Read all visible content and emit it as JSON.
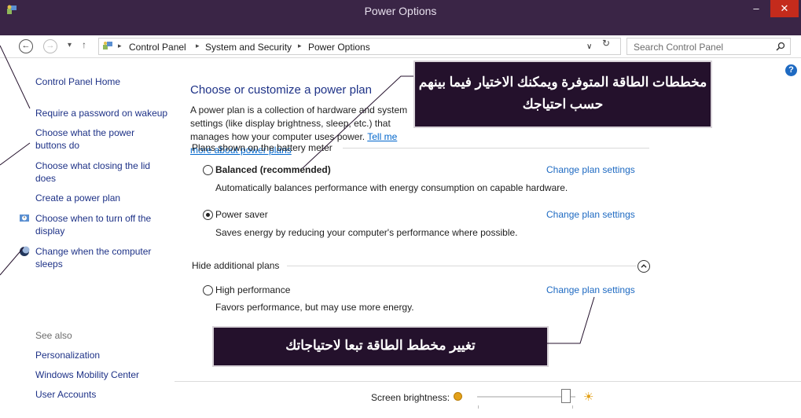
{
  "window": {
    "title": "Power Options",
    "minimize": "–",
    "maximize": "□",
    "close": "✕"
  },
  "address": {
    "back": "←",
    "forward": "→",
    "dropdown": "▾",
    "up": "↑",
    "breadcrumbs": [
      "Control Panel",
      "System and Security",
      "Power Options"
    ],
    "sep": "▸",
    "history": "∨",
    "refresh": "↻",
    "search_placeholder": "Search Control Panel"
  },
  "sidebar": {
    "home": "Control Panel Home",
    "items": [
      "Require a password on wakeup",
      "Choose what the power buttons do",
      "Choose what closing the lid does",
      "Create a power plan",
      "Choose when to turn off the display",
      "Change when the computer sleeps"
    ],
    "see_also": "See also",
    "see_also_items": [
      "Personalization",
      "Windows Mobility Center",
      "User Accounts"
    ]
  },
  "main": {
    "heading": "Choose or customize a power plan",
    "desc_text": "A power plan is a collection of hardware and system settings (like display brightness, sleep, etc.) that manages how your computer uses power.",
    "desc_link": "Tell me more about power plans",
    "battery_group": "Plans shown on the battery meter",
    "plans": [
      {
        "name": "Balanced (recommended)",
        "desc": "Automatically balances performance with energy consumption on capable hardware.",
        "link": "Change plan settings",
        "selected": false
      },
      {
        "name": "Power saver",
        "desc": "Saves energy by reducing your computer's performance where possible.",
        "link": "Change plan settings",
        "selected": true
      }
    ],
    "hidden_group": "Hide additional plans",
    "hidden_plans": [
      {
        "name": "High performance",
        "desc": "Favors performance, but may use more energy.",
        "link": "Change plan settings",
        "selected": false
      }
    ],
    "help": "?",
    "collapse": "^",
    "brightness_label": "Screen brightness:",
    "brightness_level": 0.95
  },
  "callouts": {
    "top": "مخططات الطاقة المتوفرة ويمكنك الاختيار فيما بينهم حسب احتياجك",
    "bottom": "تغيير مخطط الطاقة تبعا لاحتياجاتك"
  },
  "colors": {
    "title_bg": "#3a2546",
    "link": "#1e3287",
    "plan_link": "#1e6ac2",
    "callout_bg": "#24112c",
    "close": "#c42b1c"
  }
}
